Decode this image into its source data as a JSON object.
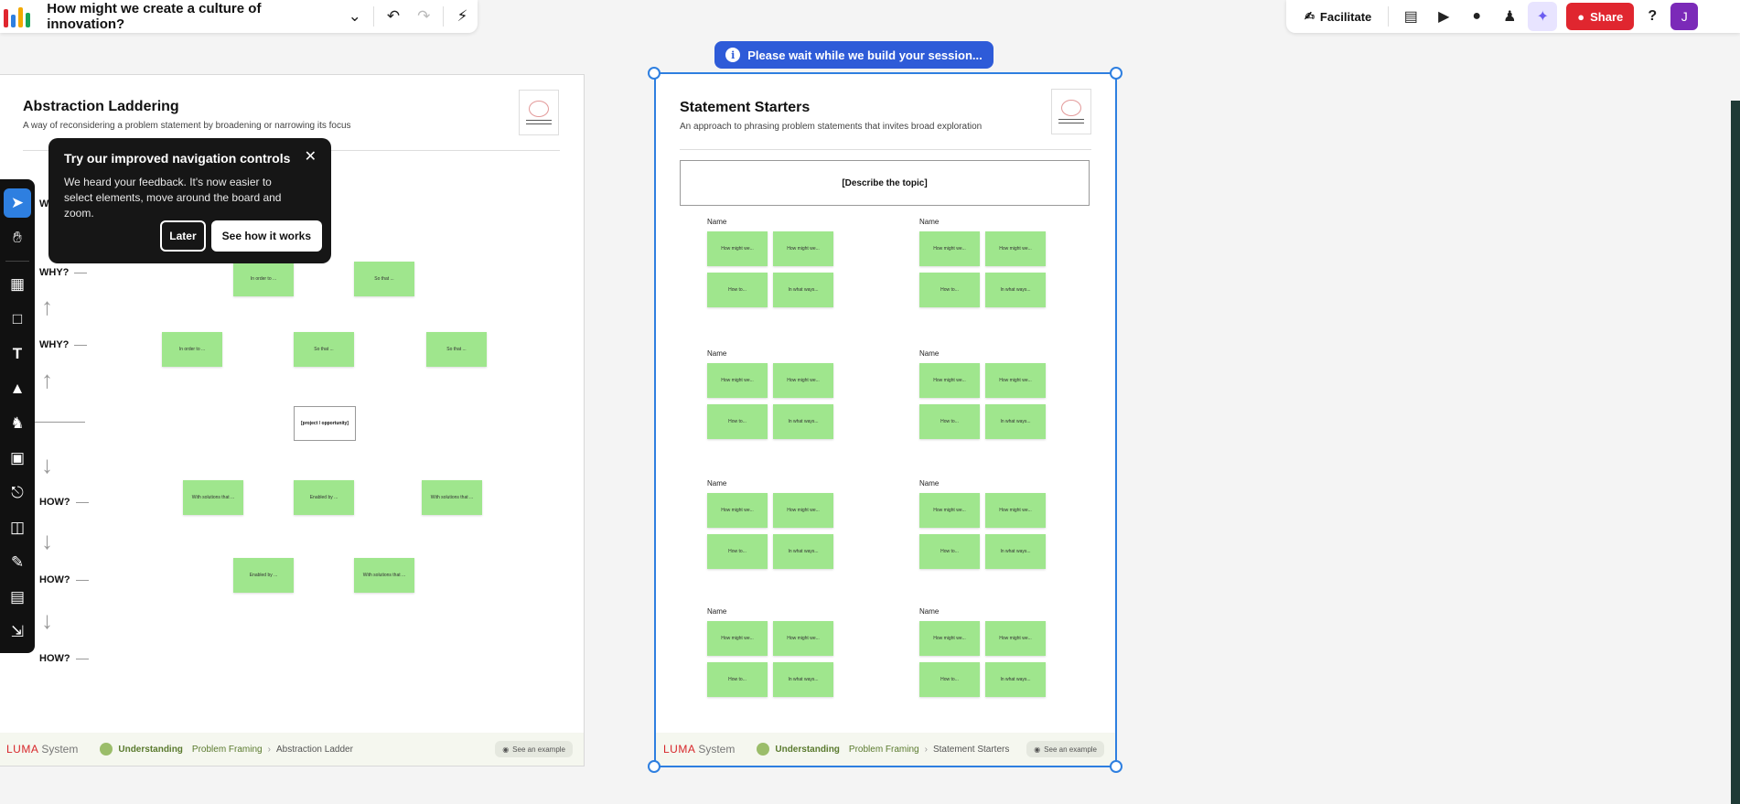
{
  "topbar": {
    "title": "How might we create a culture of innovation?",
    "facilitate_label": "Facilitate",
    "share_label": "Share",
    "avatar_initial": "J"
  },
  "banner": {
    "text": "Please wait while we build your session..."
  },
  "abstraction": {
    "title": "Abstraction Laddering",
    "subtitle": "A way of reconsidering a problem statement by broadening or narrowing its focus",
    "labels": [
      "WHY?",
      "WHY?",
      "WHY?",
      "HOW?",
      "HOW?",
      "HOW?"
    ],
    "why_row1": [
      "In order to ...",
      "So that ..."
    ],
    "why_row2": [
      "In order to ...",
      "So that ...",
      "So that ..."
    ],
    "center": "[project / opportunity]",
    "how_row1": [
      "With solutions that ...",
      "Enabled by ...",
      "With solutions that ..."
    ],
    "how_row2": [
      "Enabled by ...",
      "With solutions that ..."
    ],
    "footer": {
      "brand": "LUMA",
      "system": "System",
      "category": "Understanding",
      "group": "Problem Framing",
      "method": "Abstraction Ladder",
      "see_example": "See an example"
    }
  },
  "starters": {
    "title": "Statement Starters",
    "subtitle": "An approach to phrasing problem statements that invites broad exploration",
    "topic": "[Describe the topic]",
    "name_label": "Name",
    "sticky_labels": [
      "How might we...",
      "How might we...",
      "How to...",
      "In what ways..."
    ],
    "footer": {
      "brand": "LUMA",
      "system": "System",
      "category": "Understanding",
      "group": "Problem Framing",
      "method": "Statement Starters",
      "see_example": "See an example"
    }
  },
  "popup": {
    "title": "Try our improved navigation controls",
    "body": "We heard your feedback. It's now easier to select elements, move around the board and zoom.",
    "later_label": "Later",
    "see_label": "See how it works"
  },
  "colors": {
    "accent": "#2e7fe0",
    "share": "#e0262f",
    "sticky": "#9fe68d",
    "banner": "#2e5bd8"
  }
}
